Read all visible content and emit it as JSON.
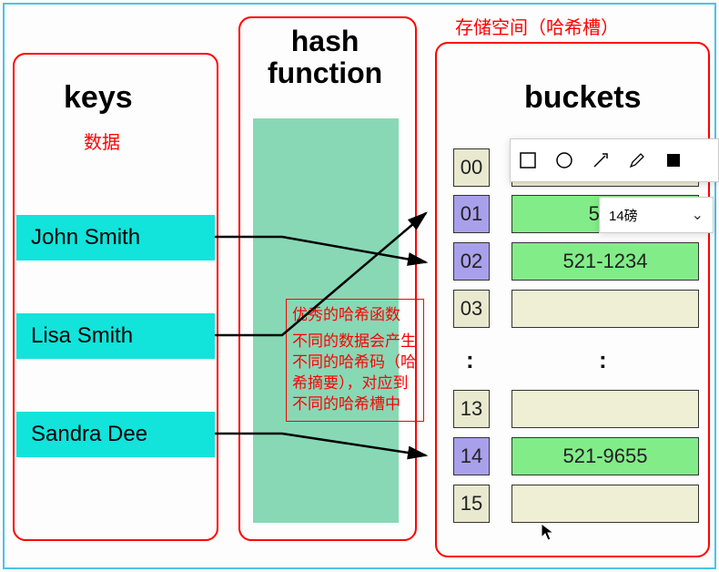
{
  "headers": {
    "keys": "keys",
    "hash_function": "hash\nfunction",
    "buckets": "buckets"
  },
  "labels": {
    "data": "数据",
    "storage": "存储空间（哈希槽）"
  },
  "keys_list": [
    "John Smith",
    "Lisa Smith",
    "Sandra Dee"
  ],
  "annotation": {
    "title": "优秀的哈希函数",
    "body": "不同的数据会产生不同的哈希码（哈希摘要），对应到不同的哈希槽中"
  },
  "buckets": {
    "top": [
      {
        "idx": "00",
        "val": "",
        "hit": false
      },
      {
        "idx": "01",
        "val": "521",
        "hit": true
      },
      {
        "idx": "02",
        "val": "521-1234",
        "hit": true
      },
      {
        "idx": "03",
        "val": "",
        "hit": false
      }
    ],
    "bottom": [
      {
        "idx": "13",
        "val": "",
        "hit": false
      },
      {
        "idx": "14",
        "val": "521-9655",
        "hit": true
      },
      {
        "idx": "15",
        "val": "",
        "hit": false
      }
    ],
    "ellipsis": ":"
  },
  "toolbar": {
    "tools": [
      "square-icon",
      "circle-icon",
      "arrow-icon",
      "pencil-icon",
      "fill-icon"
    ],
    "font_size": "14磅"
  },
  "colors": {
    "red": "#ff0000",
    "cyan": "#12e3db",
    "purple": "#a9a0ec",
    "green": "#82ed88",
    "mint": "#88d8b6"
  }
}
